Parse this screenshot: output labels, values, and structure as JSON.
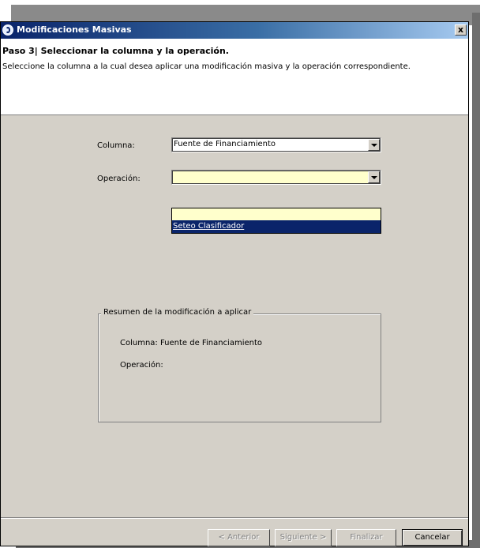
{
  "window": {
    "title": "Modificaciones Masivas",
    "close_glyph": "x"
  },
  "header": {
    "step": "Paso 3| Seleccionar la columna y la operación.",
    "description": "Seleccione la columna a la cual desea aplicar una modificación masiva y la operación correspondiente."
  },
  "form": {
    "columna_label": "Columna:",
    "columna_value": "Fuente de Financiamiento",
    "operacion_label": "Operación:",
    "operacion_value": "",
    "operacion_options": [
      "",
      "Seteo Clasificador"
    ]
  },
  "summary": {
    "legend": "Resumen de la modificación a aplicar",
    "columna": "Columna: Fuente de Financiamiento",
    "operacion": "Operación:"
  },
  "buttons": {
    "anterior": "< Anterior",
    "siguiente": "Siguiente >",
    "finalizar": "Finalizar",
    "cancelar": "Cancelar"
  },
  "colors": {
    "titlebar_start": "#0a246a",
    "titlebar_end": "#a6caf0",
    "dialog_bg": "#d4d0c8",
    "selection": "#0a246a",
    "combo_highlight": "#ffffcc"
  },
  "icons": {
    "app": "app-logo-icon",
    "close": "close-icon",
    "dropdown": "chevron-down-icon"
  }
}
